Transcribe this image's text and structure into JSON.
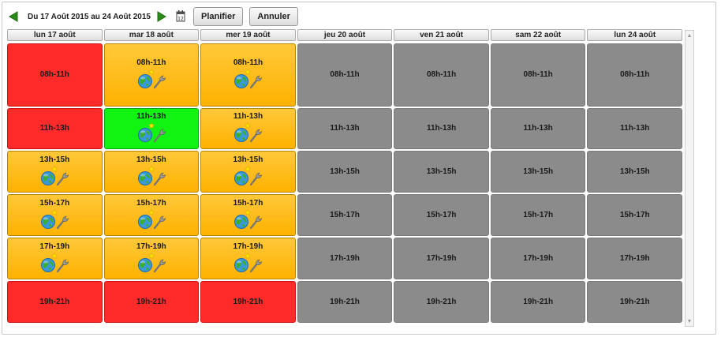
{
  "toolbar": {
    "range": "Du 17 Août 2015 au 24 Août 2015",
    "plan_label": "Planifier",
    "cancel_label": "Annuler"
  },
  "days": [
    {
      "key": "lun17",
      "label": "lun 17 août"
    },
    {
      "key": "mar18",
      "label": "mar 18 août"
    },
    {
      "key": "mer19",
      "label": "mer 19 août"
    },
    {
      "key": "jeu20",
      "label": "jeu 20 août"
    },
    {
      "key": "ven21",
      "label": "ven 21 août"
    },
    {
      "key": "sam22",
      "label": "sam 22 août"
    },
    {
      "key": "lun24",
      "label": "lun 24 août"
    }
  ],
  "rows": [
    {
      "slot": "08h-11h",
      "cells": [
        {
          "label": "08h-11h",
          "status": "red",
          "icons": false
        },
        {
          "label": "08h-11h",
          "status": "orange",
          "icons": true
        },
        {
          "label": "08h-11h",
          "status": "orange",
          "icons": true
        },
        {
          "label": "08h-11h",
          "status": "grey",
          "icons": false
        },
        {
          "label": "08h-11h",
          "status": "grey",
          "icons": false
        },
        {
          "label": "08h-11h",
          "status": "grey",
          "icons": false
        },
        {
          "label": "08h-11h",
          "status": "grey",
          "icons": false
        }
      ]
    },
    {
      "slot": "11h-13h",
      "cells": [
        {
          "label": "11h-13h",
          "status": "red",
          "icons": false
        },
        {
          "label": "11h-13h",
          "status": "green",
          "icons": true
        },
        {
          "label": "11h-13h",
          "status": "orange",
          "icons": true
        },
        {
          "label": "11h-13h",
          "status": "grey",
          "icons": false
        },
        {
          "label": "11h-13h",
          "status": "grey",
          "icons": false
        },
        {
          "label": "11h-13h",
          "status": "grey",
          "icons": false
        },
        {
          "label": "11h-13h",
          "status": "grey",
          "icons": false
        }
      ]
    },
    {
      "slot": "13h-15h",
      "cells": [
        {
          "label": "13h-15h",
          "status": "orange",
          "icons": true
        },
        {
          "label": "13h-15h",
          "status": "orange",
          "icons": true
        },
        {
          "label": "13h-15h",
          "status": "orange",
          "icons": true
        },
        {
          "label": "13h-15h",
          "status": "grey",
          "icons": false
        },
        {
          "label": "13h-15h",
          "status": "grey",
          "icons": false
        },
        {
          "label": "13h-15h",
          "status": "grey",
          "icons": false
        },
        {
          "label": "13h-15h",
          "status": "grey",
          "icons": false
        }
      ]
    },
    {
      "slot": "15h-17h",
      "cells": [
        {
          "label": "15h-17h",
          "status": "orange",
          "icons": true
        },
        {
          "label": "15h-17h",
          "status": "orange",
          "icons": true
        },
        {
          "label": "15h-17h",
          "status": "orange",
          "icons": true
        },
        {
          "label": "15h-17h",
          "status": "grey",
          "icons": false
        },
        {
          "label": "15h-17h",
          "status": "grey",
          "icons": false
        },
        {
          "label": "15h-17h",
          "status": "grey",
          "icons": false
        },
        {
          "label": "15h-17h",
          "status": "grey",
          "icons": false
        }
      ]
    },
    {
      "slot": "17h-19h",
      "cells": [
        {
          "label": "17h-19h",
          "status": "orange",
          "icons": true
        },
        {
          "label": "17h-19h",
          "status": "orange",
          "icons": true
        },
        {
          "label": "17h-19h",
          "status": "orange",
          "icons": true
        },
        {
          "label": "17h-19h",
          "status": "grey",
          "icons": false
        },
        {
          "label": "17h-19h",
          "status": "grey",
          "icons": false
        },
        {
          "label": "17h-19h",
          "status": "grey",
          "icons": false
        },
        {
          "label": "17h-19h",
          "status": "grey",
          "icons": false
        }
      ]
    },
    {
      "slot": "19h-21h",
      "cells": [
        {
          "label": "19h-21h",
          "status": "red",
          "icons": false
        },
        {
          "label": "19h-21h",
          "status": "red",
          "icons": false
        },
        {
          "label": "19h-21h",
          "status": "red",
          "icons": false
        },
        {
          "label": "19h-21h",
          "status": "grey",
          "icons": false
        },
        {
          "label": "19h-21h",
          "status": "grey",
          "icons": false
        },
        {
          "label": "19h-21h",
          "status": "grey",
          "icons": false
        },
        {
          "label": "19h-21h",
          "status": "grey",
          "icons": false
        }
      ]
    }
  ],
  "status_colors": {
    "red": "#ff2a2a",
    "orange": "#ffb200",
    "green": "#11f311",
    "grey": "#8b8b8b"
  },
  "icons": {
    "prev": "arrow-left-icon",
    "next": "arrow-right-icon",
    "calendar": "calendar-icon",
    "slot_star": "star-icon",
    "slot_globe": "globe-icon",
    "slot_tool": "wrench-icon"
  }
}
